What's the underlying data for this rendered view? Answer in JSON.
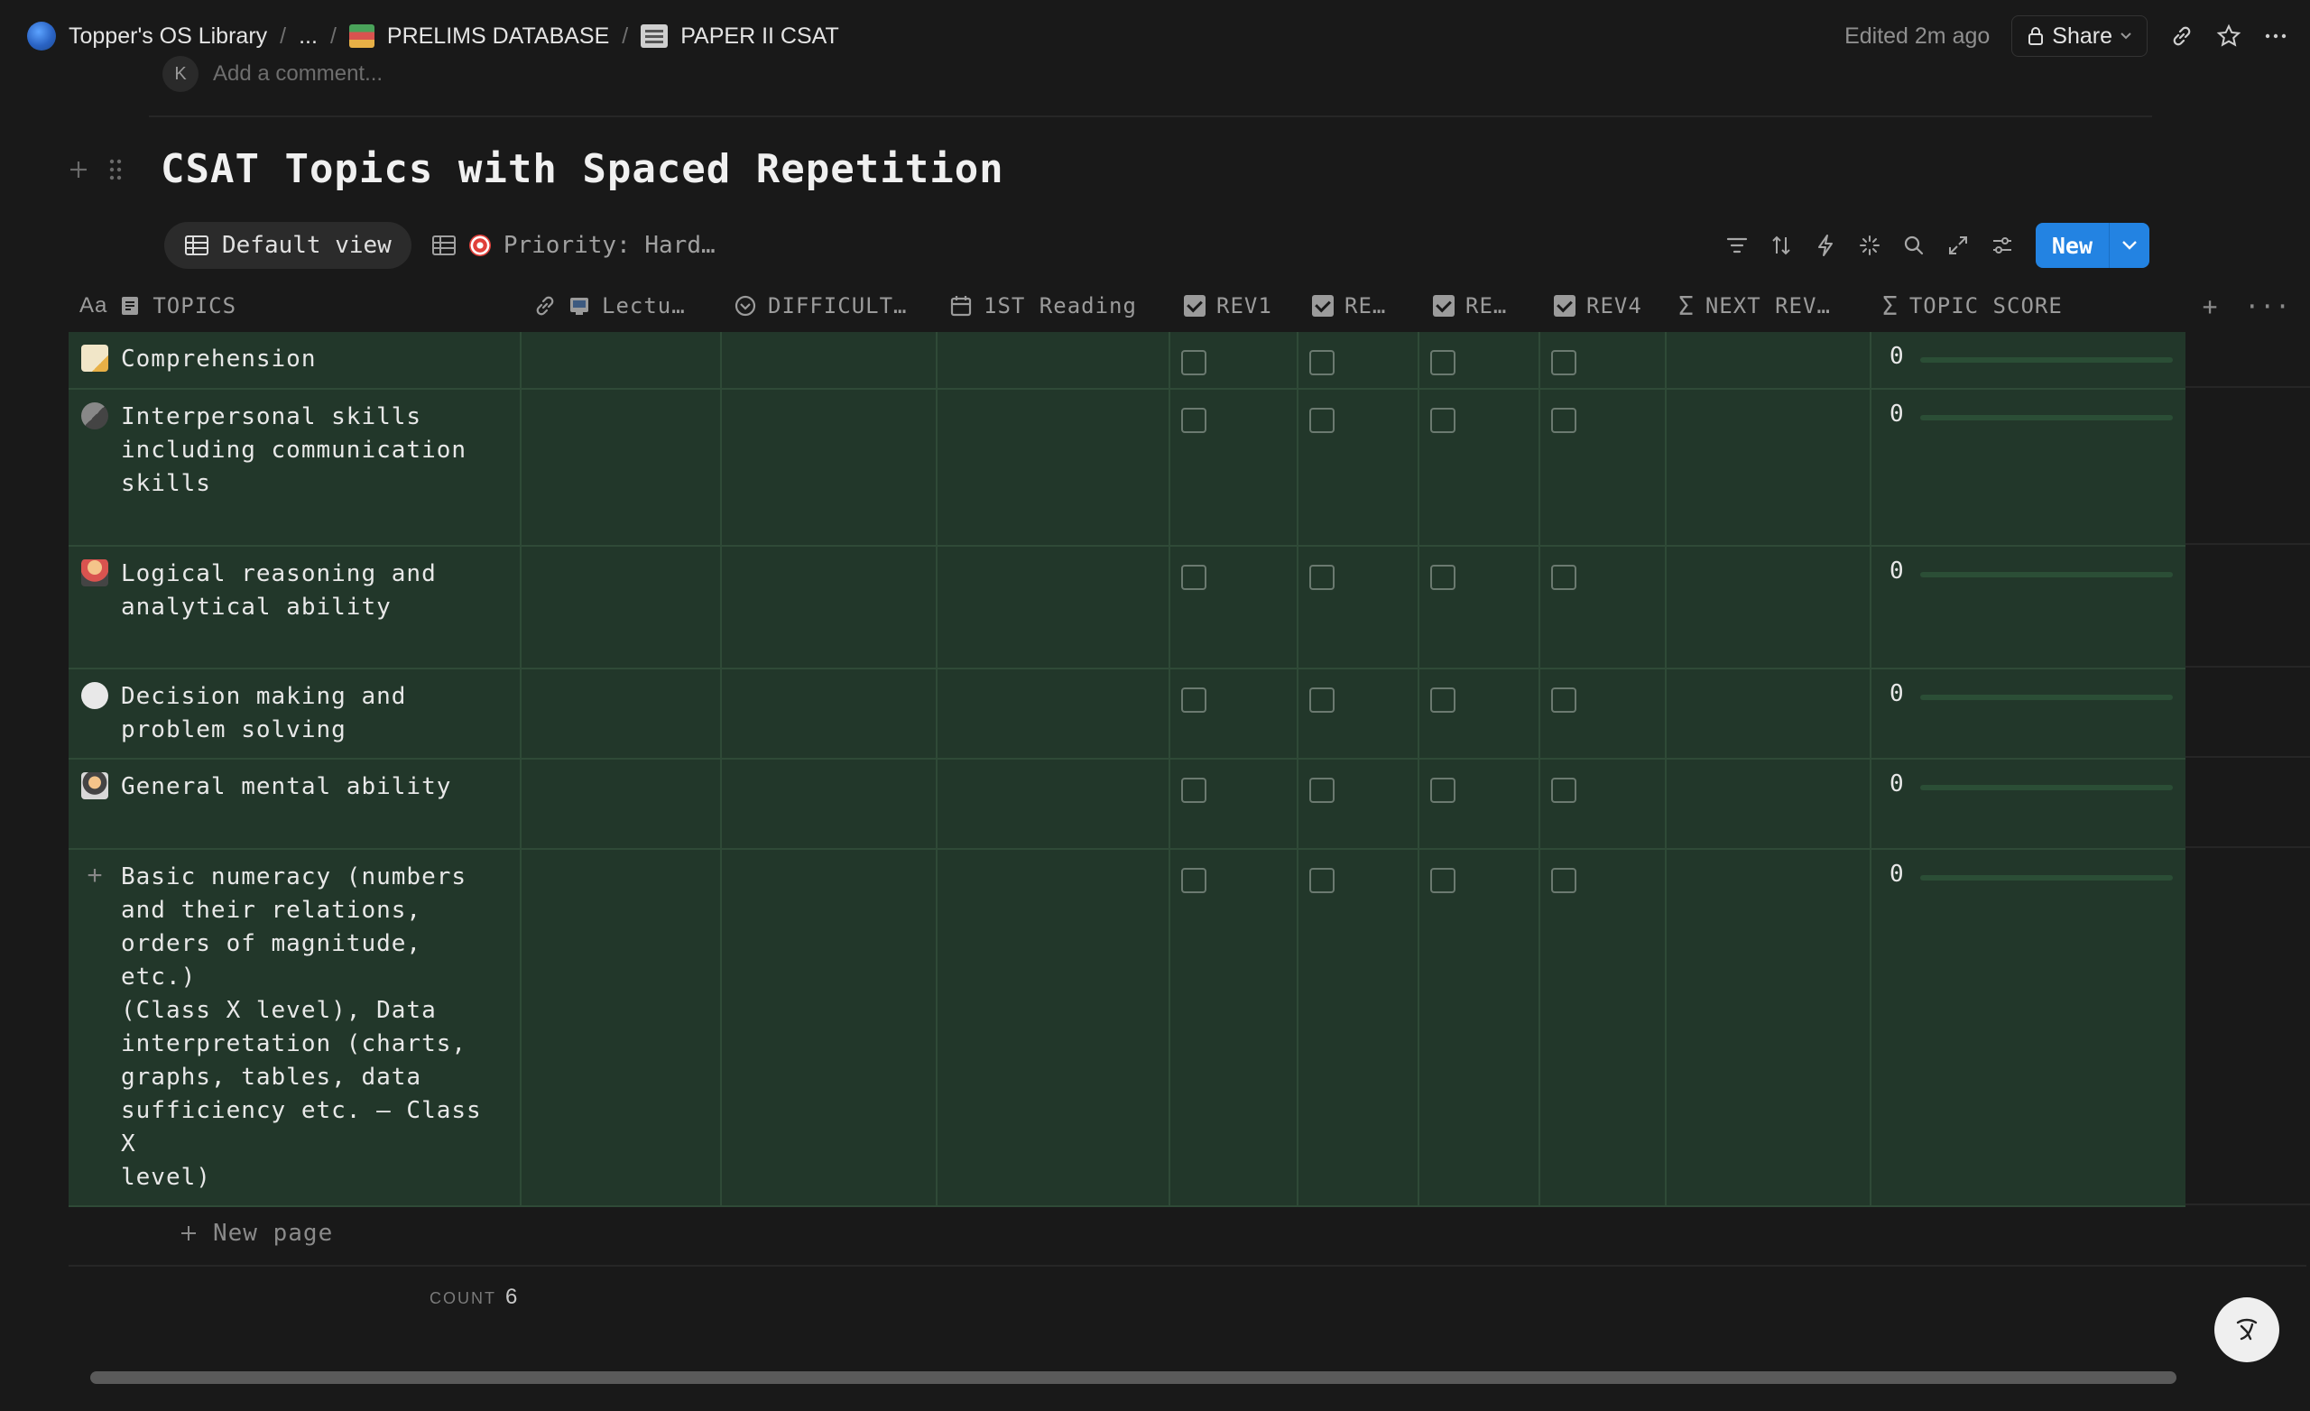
{
  "breadcrumb": {
    "items": [
      {
        "label": "Topper's OS Library",
        "icon": "globe-icon"
      },
      {
        "label": "...",
        "icon": ""
      },
      {
        "label": "PRELIMS DATABASE",
        "icon": "books-icon"
      },
      {
        "label": "PAPER II CSAT",
        "icon": "newspaper-icon"
      }
    ],
    "separator": "/"
  },
  "header": {
    "edited": "Edited 2m ago",
    "share_label": "Share"
  },
  "comment": {
    "avatar_initial": "K",
    "placeholder": "Add a comment..."
  },
  "page": {
    "title": "CSAT Topics with Spaced Repetition"
  },
  "views": {
    "default_label": "Default view",
    "priority_label": "Priority: Hard…"
  },
  "toolbar": {
    "new_label": "New"
  },
  "columns": [
    {
      "label": "TOPICS",
      "icon": "title-icon"
    },
    {
      "label": "Lectu…",
      "icon": "link-icon"
    },
    {
      "label": "DIFFICULT…",
      "icon": "select-icon"
    },
    {
      "label": "1ST Reading",
      "icon": "calendar-icon"
    },
    {
      "label": "REV1",
      "icon": "checkbox-icon"
    },
    {
      "label": "RE…",
      "icon": "checkbox-icon"
    },
    {
      "label": "RE…",
      "icon": "checkbox-icon"
    },
    {
      "label": "REV4",
      "icon": "checkbox-icon"
    },
    {
      "label": "NEXT REV…",
      "icon": "formula-icon"
    },
    {
      "label": "TOPIC SCORE",
      "icon": "formula-icon"
    }
  ],
  "rows": [
    {
      "emoji": "memo",
      "lines": [
        "Comprehension"
      ],
      "score": "0",
      "rev": [
        false,
        false,
        false,
        false
      ]
    },
    {
      "emoji": "microphone",
      "lines": [
        "Interpersonal skills",
        "including communication",
        "skills"
      ],
      "score": "0",
      "rev": [
        false,
        false,
        false,
        false
      ]
    },
    {
      "emoji": "person",
      "lines": [
        "Logical reasoning and",
        "analytical ability"
      ],
      "score": "0",
      "rev": [
        false,
        false,
        false,
        false
      ]
    },
    {
      "emoji": "thought-bubble",
      "lines": [
        "Decision making and",
        "problem solving"
      ],
      "score": "0",
      "rev": [
        false,
        false,
        false,
        false
      ]
    },
    {
      "emoji": "detective",
      "lines": [
        "General mental ability"
      ],
      "score": "0",
      "rev": [
        false,
        false,
        false,
        false
      ]
    },
    {
      "emoji": "plus",
      "lines": [
        "Basic numeracy (numbers",
        "and their relations,",
        "orders of magnitude, etc.)",
        "(Class X level), Data",
        "interpretation (charts,",
        "graphs, tables, data",
        "sufficiency etc. — Class X",
        "level)"
      ],
      "score": "0",
      "rev": [
        false,
        false,
        false,
        false
      ]
    }
  ],
  "footer": {
    "new_page_label": "New page",
    "count_label": "COUNT",
    "count_value": "6"
  },
  "colors": {
    "background": "#191919",
    "row_background": "#22372a",
    "accent": "#2383e2"
  }
}
